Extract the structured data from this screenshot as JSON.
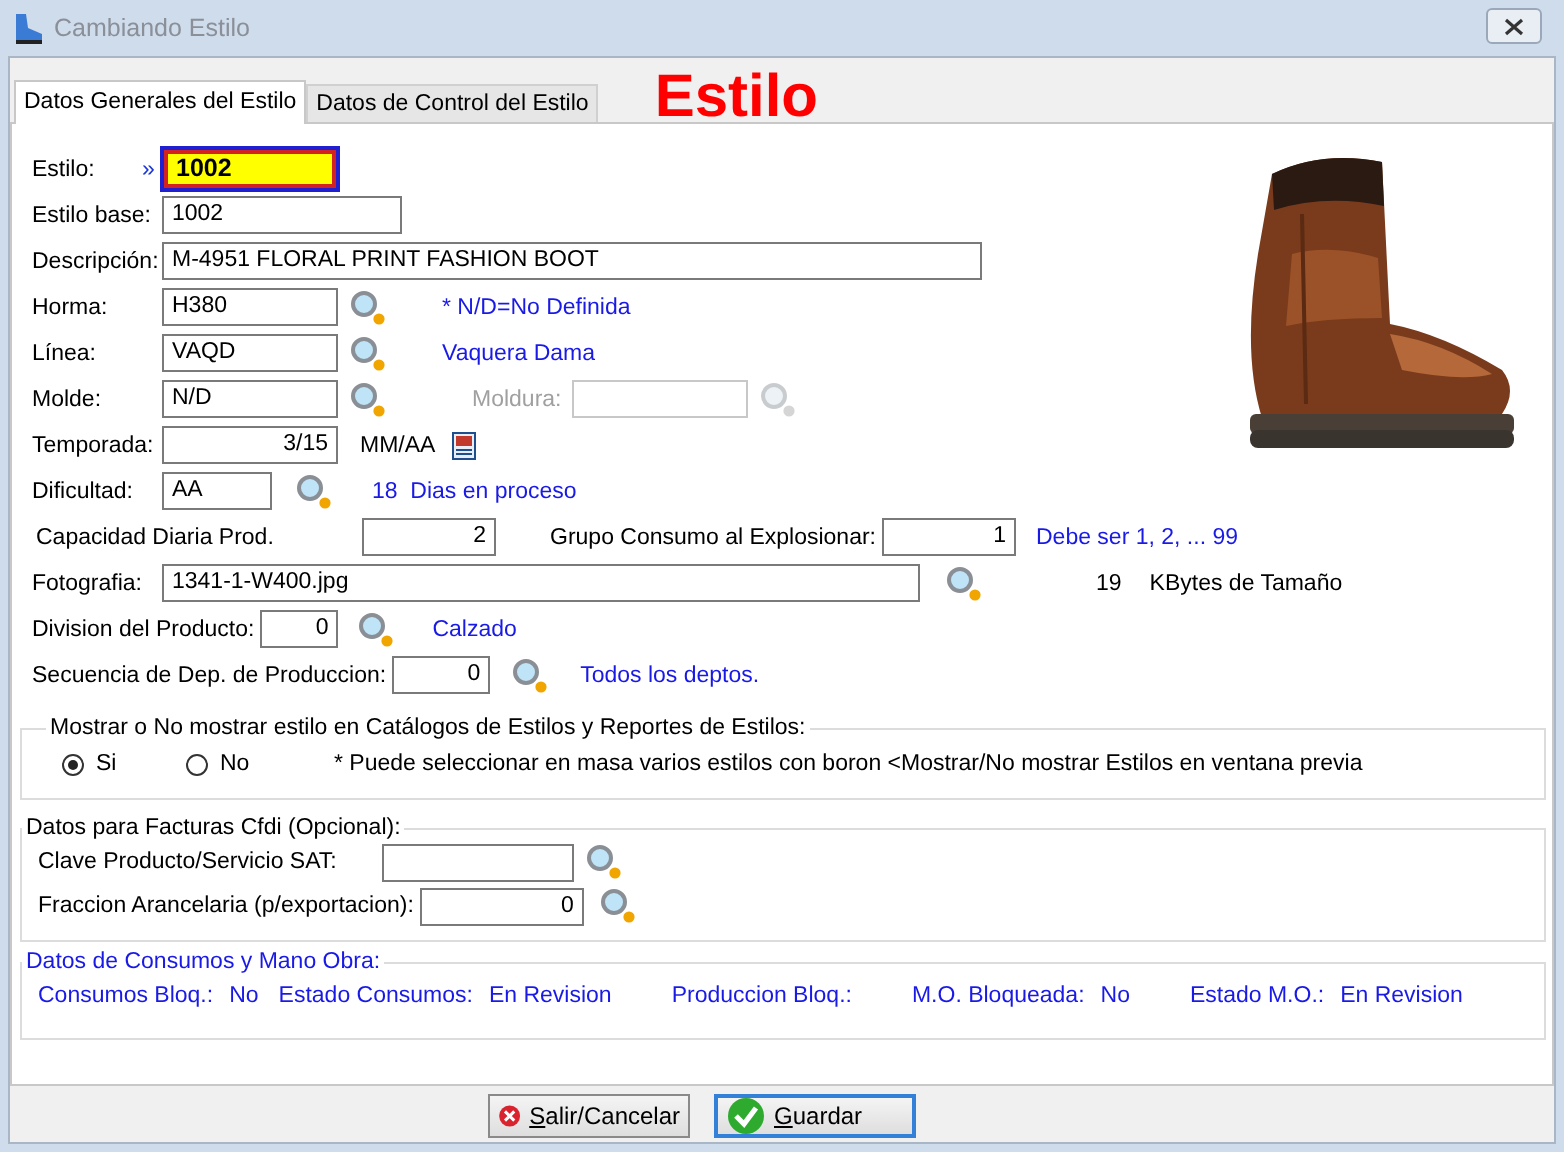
{
  "window": {
    "title": "Cambiando Estilo"
  },
  "heading": "Estilo",
  "tabs": [
    {
      "label": "Datos Generales del Estilo",
      "selected": true
    },
    {
      "label": "Datos de Control del Estilo",
      "selected": false
    }
  ],
  "estilo": {
    "label": "Estilo:",
    "marker": "»",
    "value": "1002"
  },
  "estilo_base": {
    "label": "Estilo base:",
    "value": "1002"
  },
  "descripcion": {
    "label": "Descripción:",
    "value": "M-4951 FLORAL PRINT FASHION BOOT"
  },
  "horma": {
    "label": "Horma:",
    "value": "H380",
    "note": "* N/D=No Definida"
  },
  "linea": {
    "label": "Línea:",
    "value": "VAQD",
    "note": "Vaquera Dama"
  },
  "molde": {
    "label": "Molde:",
    "value": "N/D"
  },
  "moldura": {
    "label": "Moldura:",
    "disabled": true
  },
  "temporada": {
    "label": "Temporada:",
    "value": "3/15",
    "format": "MM/AA"
  },
  "dificultad": {
    "label": "Dificultad:",
    "value": "AA",
    "note": "18  Dias en proceso"
  },
  "capacidad": {
    "label": "Capacidad Diaria Prod.",
    "value": "2"
  },
  "grupo": {
    "label": "Grupo Consumo al Explosionar:",
    "value": "1",
    "note": "Debe ser 1, 2, ... 99"
  },
  "fotografia": {
    "label": "Fotografia:",
    "value": "1341-1-W400.jpg",
    "size": "19",
    "size_label": "KBytes de Tamaño"
  },
  "division": {
    "label": "Division del Producto:",
    "value": "0",
    "note": "Calzado"
  },
  "secuencia": {
    "label": "Secuencia de Dep. de Produccion:",
    "value": "0",
    "note": "Todos los deptos."
  },
  "mostrar": {
    "title": "Mostrar o No mostrar estilo en Catálogos de Estilos y Reportes de Estilos:",
    "options": [
      {
        "label": "Si",
        "selected": true
      },
      {
        "label": "No",
        "selected": false
      }
    ],
    "note": "* Puede seleccionar en masa varios estilos con boron <Mostrar/No mostrar Estilos en ventana previa"
  },
  "facturas": {
    "title": "Datos para Facturas Cfdi (Opcional):",
    "clave": {
      "label": "Clave Producto/Servicio SAT:"
    },
    "fraccion": {
      "label": "Fraccion Arancelaria (p/exportacion):",
      "value": "0"
    }
  },
  "consumos": {
    "title": "Datos de Consumos y Mano Obra:",
    "items": [
      {
        "label": "Consumos Bloq.:",
        "value": "No"
      },
      {
        "label": "Estado Consumos:",
        "value": "En Revision"
      },
      {
        "label": "Produccion Bloq.:"
      },
      {
        "label": "M.O. Bloqueada:",
        "value": "No"
      },
      {
        "label": "Estado M.O.:",
        "value": "En Revision"
      }
    ]
  },
  "buttons": [
    {
      "label": "Salir/Cancelar",
      "kind": "cancel",
      "focused": false
    },
    {
      "label": "Guardar",
      "kind": "save",
      "focused": true
    }
  ]
}
